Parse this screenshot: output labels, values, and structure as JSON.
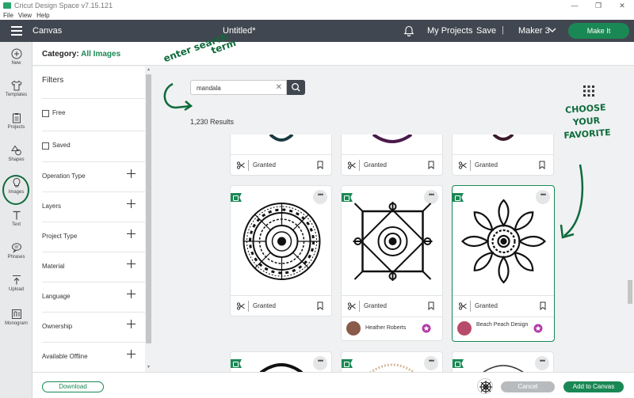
{
  "window": {
    "title": "Cricut Design Space  v7.15.121",
    "min": "—",
    "max": "❐",
    "close": "✕"
  },
  "menu": [
    "File",
    "View",
    "Help"
  ],
  "header": {
    "canvas_label": "Canvas",
    "doc_title": "Untitled*",
    "my_projects": "My Projects",
    "save": "Save",
    "separator": "|",
    "machine": "Maker 3",
    "make_it": "Make It"
  },
  "toolbar": [
    {
      "label": "New",
      "icon": "plus-circle-icon"
    },
    {
      "label": "Templates",
      "icon": "shirt-icon"
    },
    {
      "label": "Projects",
      "icon": "clipboard-icon"
    },
    {
      "label": "Shapes",
      "icon": "shapes-icon"
    },
    {
      "label": "Images",
      "icon": "lightbulb-icon"
    },
    {
      "label": "Text",
      "icon": "text-t-icon"
    },
    {
      "label": "Phrases",
      "icon": "speech-bubble-icon"
    },
    {
      "label": "Upload",
      "icon": "upload-arrow-icon"
    },
    {
      "label": "Monogram",
      "icon": "monogram-icon"
    }
  ],
  "category": {
    "label": "Category:",
    "value": "All Images"
  },
  "filters": {
    "title": "Filters",
    "checkboxes": [
      "Free",
      "Saved"
    ],
    "groups": [
      "Operation Type",
      "Layers",
      "Project Type",
      "Material",
      "Language",
      "Ownership",
      "Available Offline"
    ]
  },
  "search": {
    "value": "mandala",
    "clear": "✕",
    "results": "1,230 Results"
  },
  "cards": {
    "granted": "Granted",
    "more": "•••",
    "designers": {
      "heather": "Heather Roberts",
      "beach": "Beach Peach Design"
    }
  },
  "footer": {
    "download": "Download",
    "cancel": "Cancel",
    "add": "Add to Canvas"
  },
  "annotations": {
    "search_line1": "enter search",
    "search_line2": "term",
    "choose": [
      "CHOOSE",
      "YOUR",
      "FAVORITE"
    ]
  },
  "colors": {
    "accent": "#1a8854",
    "header": "#414750",
    "annotation": "#0e6b3c"
  }
}
